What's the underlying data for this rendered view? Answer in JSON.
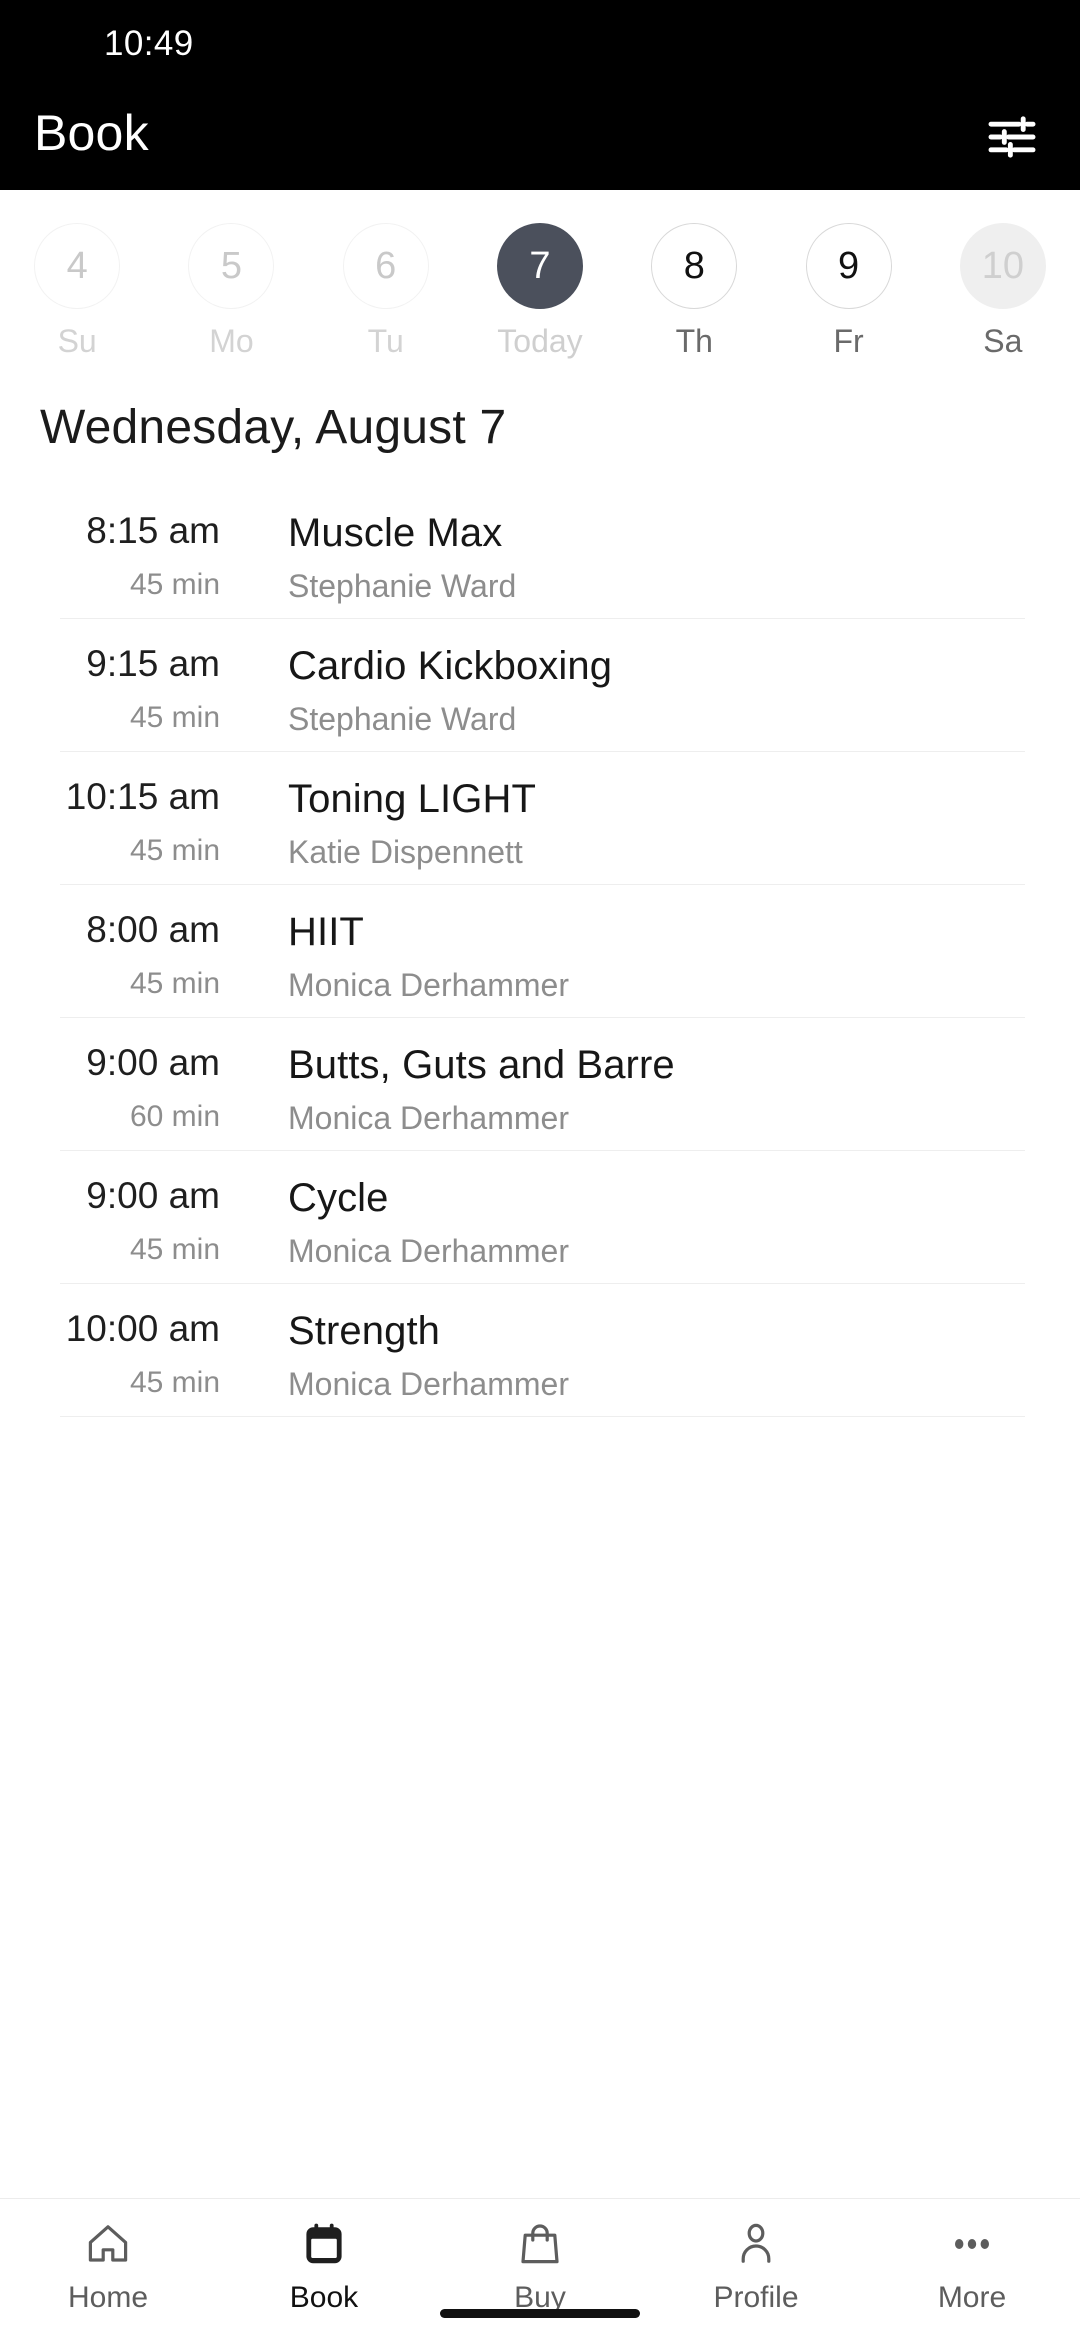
{
  "status_bar": {
    "time": "10:49"
  },
  "app_bar": {
    "title": "Book",
    "filter_icon": "tune-filter-icon"
  },
  "theme": {
    "header_bg": "#000000",
    "selected_day_bg": "#4b505c",
    "page_bg": "#ffffff",
    "muted_text": "#8d8d8d",
    "divider": "#eeeeee"
  },
  "date_strip": {
    "days": [
      {
        "number": "4",
        "weekday": "Su",
        "state": "past"
      },
      {
        "number": "5",
        "weekday": "Mo",
        "state": "past"
      },
      {
        "number": "6",
        "weekday": "Tu",
        "state": "past"
      },
      {
        "number": "7",
        "weekday": "Today",
        "state": "today"
      },
      {
        "number": "8",
        "weekday": "Th",
        "state": "future"
      },
      {
        "number": "9",
        "weekday": "Fr",
        "state": "future"
      },
      {
        "number": "10",
        "weekday": "Sa",
        "state": "dim"
      }
    ]
  },
  "schedule": {
    "heading": "Wednesday, August 7",
    "classes": [
      {
        "time": "8:15 am",
        "duration": "45 min",
        "name": "Muscle Max",
        "instructor": "Stephanie Ward"
      },
      {
        "time": "9:15 am",
        "duration": "45 min",
        "name": "Cardio Kickboxing",
        "instructor": "Stephanie Ward"
      },
      {
        "time": "10:15 am",
        "duration": "45 min",
        "name": "Toning LIGHT",
        "instructor": "Katie Dispennett"
      },
      {
        "time": "8:00 am",
        "duration": "45 min",
        "name": "HIIT",
        "instructor": "Monica Derhammer"
      },
      {
        "time": "9:00 am",
        "duration": "60 min",
        "name": "Butts, Guts and Barre",
        "instructor": "Monica Derhammer"
      },
      {
        "time": "9:00 am",
        "duration": "45 min",
        "name": "Cycle",
        "instructor": "Monica Derhammer"
      },
      {
        "time": "10:00 am",
        "duration": "45 min",
        "name": "Strength",
        "instructor": "Monica Derhammer"
      }
    ]
  },
  "bottom_nav": {
    "items": [
      {
        "label": "Home",
        "icon": "home-icon",
        "active": false
      },
      {
        "label": "Book",
        "icon": "calendar-icon",
        "active": true
      },
      {
        "label": "Buy",
        "icon": "bag-icon",
        "active": false
      },
      {
        "label": "Profile",
        "icon": "person-icon",
        "active": false
      },
      {
        "label": "More",
        "icon": "ellipsis-icon",
        "active": false
      }
    ]
  }
}
